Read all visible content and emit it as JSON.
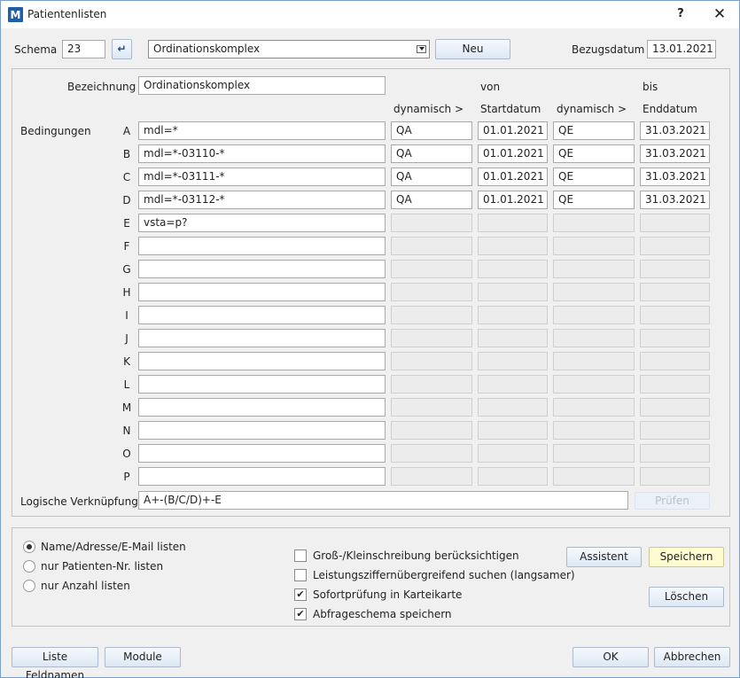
{
  "window": {
    "title": "Patientenlisten",
    "icon": "app-logo-icon",
    "help": "?",
    "close": "✕"
  },
  "header": {
    "schema_label": "Schema",
    "schema_value": "23",
    "enter_icon": "↵",
    "schema_name": "Ordinationskomplex",
    "new_label": "Neu",
    "ref_date_label": "Bezugsdatum",
    "ref_date_value": "13.01.2021"
  },
  "form": {
    "bezeichnung_label": "Bezeichnung",
    "bezeichnung_value": "Ordinationskomplex",
    "von": "von",
    "bis": "bis",
    "dyn1": "dynamisch >",
    "startdatum": "Startdatum",
    "dyn2": "dynamisch >",
    "enddatum": "Enddatum",
    "bedingungen_label": "Bedingungen",
    "conditions": [
      {
        "letter": "A",
        "value": "mdl=*",
        "dyn_start": "QA",
        "start": "01.01.2021",
        "dyn_end": "QE",
        "end": "31.03.2021"
      },
      {
        "letter": "B",
        "value": "mdl=*-03110-*",
        "dyn_start": "QA",
        "start": "01.01.2021",
        "dyn_end": "QE",
        "end": "31.03.2021"
      },
      {
        "letter": "C",
        "value": "mdl=*-03111-*",
        "dyn_start": "QA",
        "start": "01.01.2021",
        "dyn_end": "QE",
        "end": "31.03.2021"
      },
      {
        "letter": "D",
        "value": "mdl=*-03112-*",
        "dyn_start": "QA",
        "start": "01.01.2021",
        "dyn_end": "QE",
        "end": "31.03.2021"
      },
      {
        "letter": "E",
        "value": "vsta=p?"
      },
      {
        "letter": "F",
        "value": ""
      },
      {
        "letter": "G",
        "value": ""
      },
      {
        "letter": "H",
        "value": ""
      },
      {
        "letter": "I",
        "value": ""
      },
      {
        "letter": "J",
        "value": ""
      },
      {
        "letter": "K",
        "value": ""
      },
      {
        "letter": "L",
        "value": ""
      },
      {
        "letter": "M",
        "value": ""
      },
      {
        "letter": "N",
        "value": ""
      },
      {
        "letter": "O",
        "value": ""
      },
      {
        "letter": "P",
        "value": ""
      }
    ],
    "logic_label": "Logische Verknüpfung",
    "logic_value": "A+-(B/C/D)+-E",
    "check_label": "Prüfen"
  },
  "options": {
    "radios": [
      {
        "label": "Name/Adresse/E-Mail listen",
        "checked": true
      },
      {
        "label": "nur Patienten-Nr. listen",
        "checked": false
      },
      {
        "label": "nur Anzahl listen",
        "checked": false
      }
    ],
    "checkboxes": [
      {
        "label": "Groß-/Kleinschreibung berücksichtigen",
        "checked": false
      },
      {
        "label": "Leistungsziffernübergreifend suchen (langsamer)",
        "checked": false
      },
      {
        "label": "Sofortprüfung in Karteikarte",
        "checked": true
      },
      {
        "label": "Abfrageschema speichern",
        "checked": true
      }
    ],
    "assistant_label": "Assistent",
    "save_label": "Speichern",
    "delete_label": "Löschen"
  },
  "footer": {
    "field_names_label": "Liste Feldnamen",
    "modules_label": "Module",
    "ok_label": "OK",
    "cancel_label": "Abbrechen"
  }
}
